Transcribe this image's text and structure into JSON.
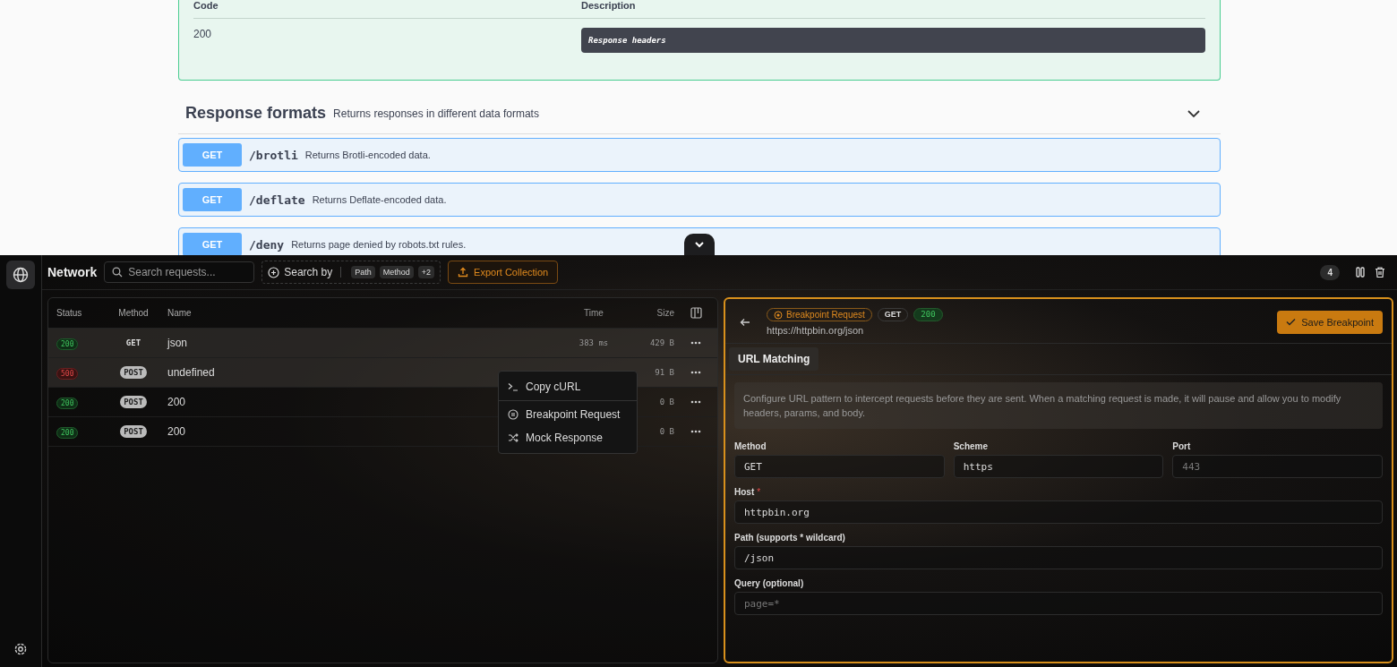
{
  "docs": {
    "response_table": {
      "columns": [
        "Code",
        "Description"
      ],
      "rows": [
        {
          "code": "200",
          "description": "Response headers"
        }
      ]
    },
    "section": {
      "title": "Response formats",
      "description": "Returns responses in different data formats",
      "expanded": true
    },
    "operations": [
      {
        "method": "GET",
        "path": "/brotli",
        "summary": "Returns Brotli-encoded data."
      },
      {
        "method": "GET",
        "path": "/deflate",
        "summary": "Returns Deflate-encoded data."
      },
      {
        "method": "GET",
        "path": "/deny",
        "summary": "Returns page denied by robots.txt rules."
      }
    ]
  },
  "toolbar": {
    "title": "Network",
    "search": {
      "placeholder": "Search requests..."
    },
    "search_by": {
      "label": "Search by",
      "chips": [
        "Path",
        "Method",
        "+2"
      ]
    },
    "export_button": "Export Collection",
    "count": "4"
  },
  "table": {
    "columns": [
      "Status",
      "Method",
      "Name",
      "Time",
      "Size"
    ],
    "rows": [
      {
        "status": "200",
        "ok": true,
        "method": "GET",
        "badge": false,
        "name": "json",
        "time": "383 ms",
        "size": "429 B",
        "selected": true
      },
      {
        "status": "500",
        "ok": false,
        "method": "POST",
        "badge": true,
        "name": "undefined",
        "size": "91 B",
        "selected": true
      },
      {
        "status": "200",
        "ok": true,
        "method": "POST",
        "badge": true,
        "name": "200",
        "size": "0 B",
        "selected": false
      },
      {
        "status": "200",
        "ok": true,
        "method": "POST",
        "badge": true,
        "name": "200",
        "size": "0 B",
        "selected": false
      }
    ]
  },
  "context_menu": [
    {
      "label": "Copy cURL",
      "kind": "terminal"
    },
    {
      "label": "Breakpoint Request",
      "kind": "pause"
    },
    {
      "label": "Mock Response",
      "kind": "shuffle"
    }
  ],
  "detail": {
    "tag": "Breakpoint Request",
    "method": "GET",
    "status": "200",
    "url": "https://httpbin.org/json",
    "save_button": "Save Breakpoint",
    "tabs": [
      {
        "label": "URL Matching",
        "selected": true
      }
    ],
    "info": "Configure URL pattern to intercept requests before they are sent. When a matching request is made, it will pause and allow you to modify headers, params, and body.",
    "row_fields": [
      {
        "label": "Method",
        "value": "GET"
      },
      {
        "label": "Scheme",
        "value": "https"
      },
      {
        "label": "Port",
        "placeholder": "443"
      }
    ],
    "fields": [
      {
        "label": "Host",
        "required_mark": "*",
        "value": "httpbin.org"
      },
      {
        "label": "Path (supports * wildcard)",
        "value": "/json"
      },
      {
        "label": "Query (optional)",
        "placeholder": "page=*"
      }
    ]
  }
}
